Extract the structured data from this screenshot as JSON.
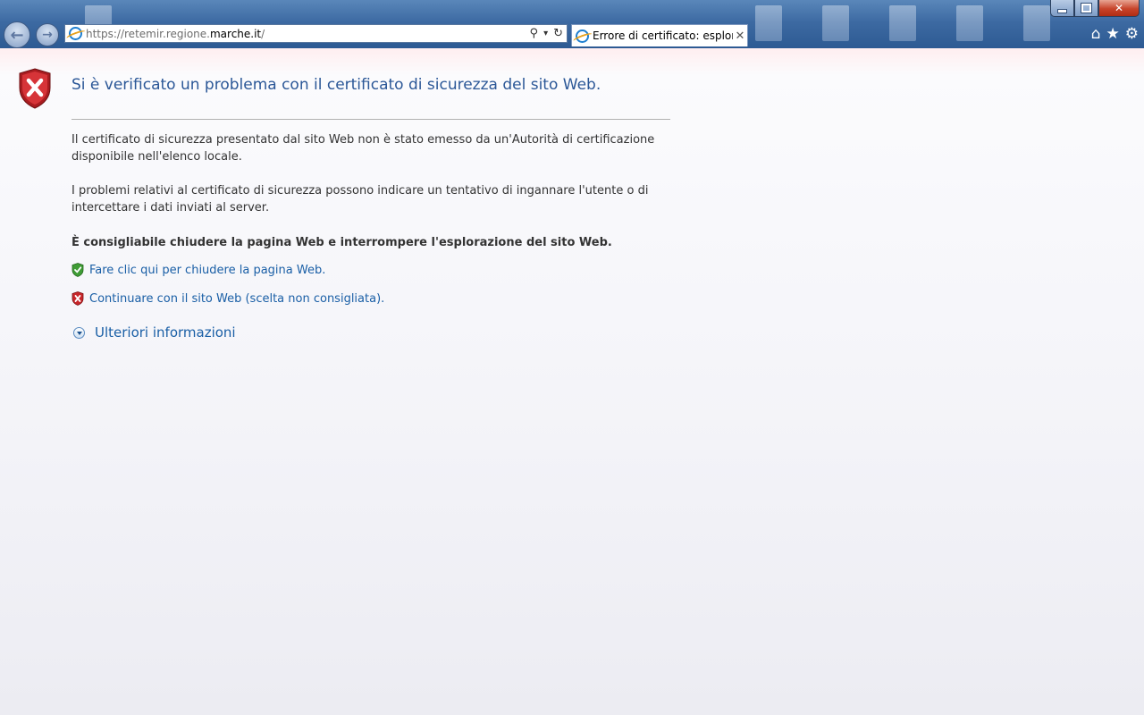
{
  "window": {
    "minimize_icon": "minimize-icon",
    "maximize_icon": "restore-icon",
    "close_label": "✕"
  },
  "toolbar": {
    "back_glyph": "←",
    "forward_glyph": "→",
    "address": {
      "prefix": "https://retemir.regione.",
      "domain": "marche.it",
      "suffix": "/"
    },
    "search_glyph": "⚲",
    "dropdown_glyph": "▾",
    "refresh_glyph": "↻",
    "tab": {
      "title": "Errore di certificato: esplora...",
      "close_glyph": "✕"
    },
    "home_glyph": "⌂",
    "favorites_glyph": "★",
    "tools_glyph": "⚙"
  },
  "page": {
    "heading": "Si è verificato un problema con il certificato di sicurezza del sito Web.",
    "paragraph1": "Il certificato di sicurezza presentato dal sito Web non è stato emesso da un'Autorità di certificazione disponibile nell'elenco locale.",
    "paragraph2": "I problemi relativi al certificato di sicurezza possono indicare un tentativo di ingannare l'utente o di intercettare i dati inviati al server.",
    "advice": "È consigliabile chiudere la pagina Web e interrompere l'esplorazione del sito Web.",
    "close_link": "Fare clic qui per chiudere la pagina Web.",
    "continue_link": "Continuare con il sito Web (scelta non consigliata).",
    "more_info": "Ulteriori informazioni"
  },
  "colors": {
    "heading": "#2b5797",
    "link": "#1a5fa6",
    "shield_red": "#c8262a",
    "shield_green": "#3f9c35"
  }
}
